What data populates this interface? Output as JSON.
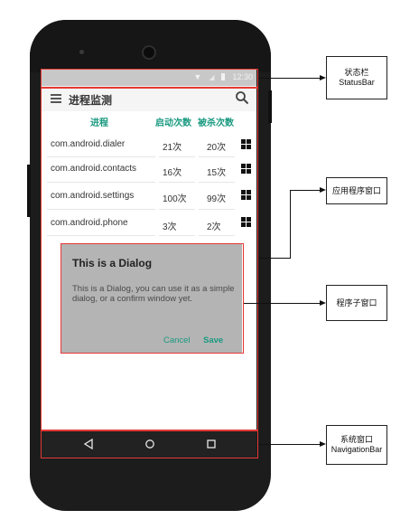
{
  "status_bar": {
    "time": "12:30"
  },
  "toolbar": {
    "title": "进程监测"
  },
  "table": {
    "headers": [
      "进程",
      "启动次数",
      "被杀次数"
    ],
    "rows": [
      {
        "process": "com.android.dialer",
        "starts": "21次",
        "kills": "20次"
      },
      {
        "process": "com.android.contacts",
        "starts": "16次",
        "kills": "15次"
      },
      {
        "process": "com.android.settings",
        "starts": "100次",
        "kills": "99次"
      },
      {
        "process": "com.android.phone",
        "starts": "3次",
        "kills": "2次"
      }
    ]
  },
  "dialog": {
    "title": "This is a Dialog",
    "body": "This is a Dialog, you can use it as a simple dialog, or a confirm window yet.",
    "cancel": "Cancel",
    "save": "Save"
  },
  "annotations": {
    "status_bar": [
      "状态栏",
      "StatusBar"
    ],
    "app_window": "应用程序窗口",
    "sub_window": "程序子窗口",
    "system_window": [
      "系统窗口",
      "NavigationBar"
    ]
  },
  "colors": {
    "accent": "#1a9a80",
    "highlight": "#e53935",
    "dialog_bg": "#b4b4b4",
    "navbar_bg": "#222222",
    "statusbar_bg": "#c8c8c8"
  },
  "icons": {
    "menu": "menu-icon",
    "search": "search-icon",
    "row_action": "grid-icon",
    "nav_back": "back-triangle-icon",
    "nav_home": "home-circle-icon",
    "nav_recents": "recents-square-icon"
  }
}
